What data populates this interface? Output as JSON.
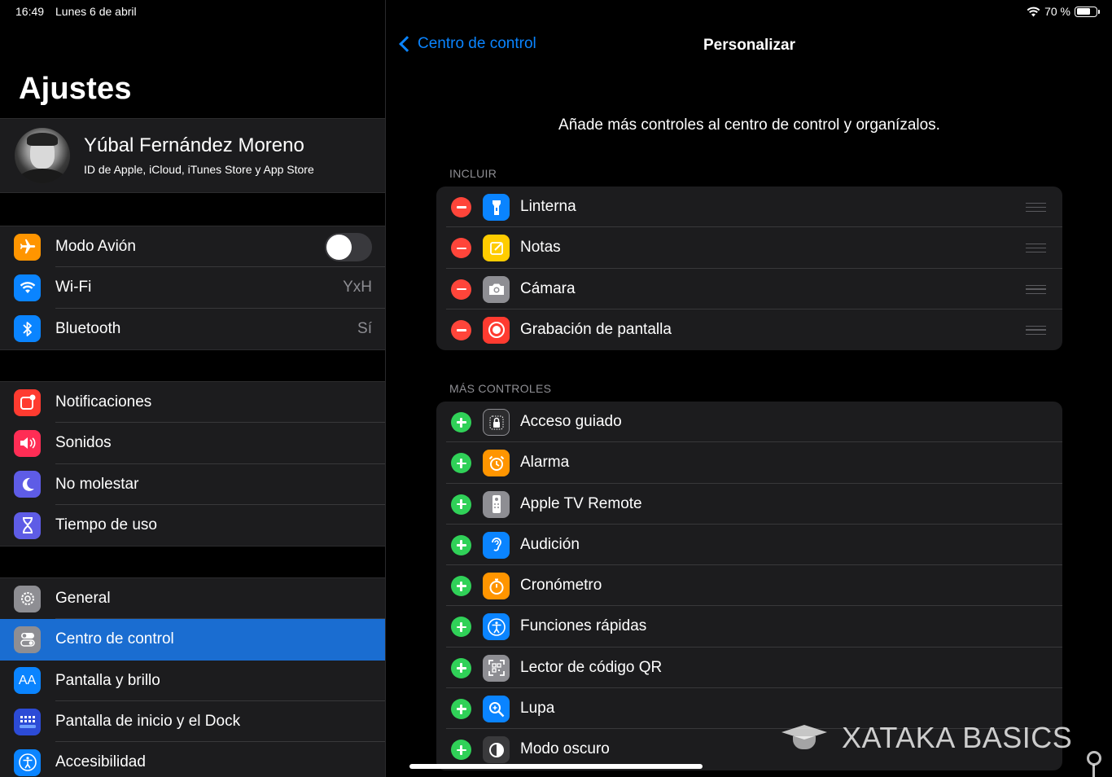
{
  "status_bar": {
    "time": "16:49",
    "date": "Lunes 6 de abril",
    "battery": "70 %"
  },
  "sidebar": {
    "title": "Ajustes",
    "profile": {
      "name": "Yúbal Fernández Moreno",
      "subtitle": "ID de Apple, iCloud, iTunes Store y App Store"
    },
    "group1": [
      {
        "label": "Modo Avión",
        "icon": "airplane-icon",
        "color": "#ff9500",
        "toggle": false
      },
      {
        "label": "Wi-Fi",
        "icon": "wifi-icon",
        "color": "#0a84ff",
        "value": "YxH"
      },
      {
        "label": "Bluetooth",
        "icon": "bluetooth-icon",
        "color": "#0a84ff",
        "value": "Sí"
      }
    ],
    "group2": [
      {
        "label": "Notificaciones",
        "icon": "notifications-icon",
        "color": "#ff3b30"
      },
      {
        "label": "Sonidos",
        "icon": "speaker-icon",
        "color": "#ff2d55"
      },
      {
        "label": "No molestar",
        "icon": "moon-icon",
        "color": "#5e5ce6"
      },
      {
        "label": "Tiempo de uso",
        "icon": "hourglass-icon",
        "color": "#5e5ce6"
      }
    ],
    "group3": [
      {
        "label": "General",
        "icon": "gear-icon",
        "color": "#8e8e93"
      },
      {
        "label": "Centro de control",
        "icon": "switches-icon",
        "color": "#8e8e93",
        "selected": true
      },
      {
        "label": "Pantalla y brillo",
        "icon": "text-size-icon",
        "color": "#0a84ff"
      },
      {
        "label": "Pantalla de inicio y el Dock",
        "icon": "home-grid-icon",
        "color": "#2c4bd6"
      },
      {
        "label": "Accesibilidad",
        "icon": "accessibility-icon",
        "color": "#0a84ff"
      }
    ]
  },
  "detail": {
    "back_label": "Centro de control",
    "title": "Personalizar",
    "description": "Añade más controles al centro de control y organízalos.",
    "include_header": "INCLUIR",
    "include": [
      {
        "label": "Linterna",
        "icon": "flashlight-icon",
        "color": "#0a84ff"
      },
      {
        "label": "Notas",
        "icon": "notes-icon",
        "color": "#ffcc00"
      },
      {
        "label": "Cámara",
        "icon": "camera-icon",
        "color": "#8e8e93"
      },
      {
        "label": "Grabación de pantalla",
        "icon": "record-icon",
        "color": "#ff3b30"
      }
    ],
    "more_header": "MÁS CONTROLES",
    "more": [
      {
        "label": "Acceso guiado",
        "icon": "lock-icon",
        "color": "#2c2c2e"
      },
      {
        "label": "Alarma",
        "icon": "alarm-icon",
        "color": "#ff9500"
      },
      {
        "label": "Apple TV Remote",
        "icon": "remote-icon",
        "color": "#8e8e93"
      },
      {
        "label": "Audición",
        "icon": "ear-icon",
        "color": "#0a84ff"
      },
      {
        "label": "Cronómetro",
        "icon": "stopwatch-icon",
        "color": "#ff9500"
      },
      {
        "label": "Funciones rápidas",
        "icon": "accessibility-icon",
        "color": "#0a84ff"
      },
      {
        "label": "Lector de código QR",
        "icon": "qr-icon",
        "color": "#8e8e93"
      },
      {
        "label": "Lupa",
        "icon": "magnifier-icon",
        "color": "#0a84ff"
      },
      {
        "label": "Modo oscuro",
        "icon": "dark-mode-icon",
        "color": "#3a3a3c"
      }
    ]
  },
  "watermark": "XATAKA BASICS"
}
